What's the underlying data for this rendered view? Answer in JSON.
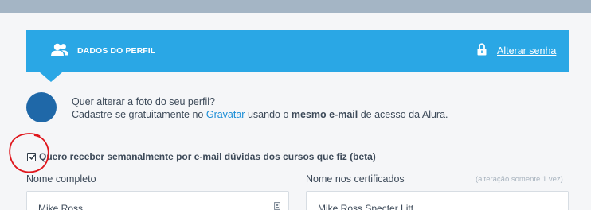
{
  "header": {
    "title": "DADOS DO PERFIL",
    "change_password": "Alterar senha",
    "color": "#2aa7e5"
  },
  "photo": {
    "question": "Quer alterar a foto do seu perfil?",
    "desc_prefix": "Cadastre-se gratuitamente no ",
    "link": "Gravatar",
    "desc_mid": " usando o ",
    "desc_bold": "mesmo e-mail",
    "desc_suffix": " de acesso da Alura."
  },
  "newsletter": {
    "label": "Quero receber semanalmente por e-mail dúvidas dos cursos que fiz (beta)",
    "checked": true
  },
  "fields": {
    "full_name_label": "Nome completo",
    "full_name_value": "Mike Ross",
    "cert_name_label": "Nome nos certificados",
    "cert_name_hint": "(alteração somente 1 vez)",
    "cert_name_value": "Mike Ross Specter Litt"
  },
  "icons": {
    "users": "users-icon",
    "lock": "lock-icon",
    "checkbox": "checkbox-checked-icon",
    "contact": "contact-card-icon"
  },
  "annotation_color": "#e0161c"
}
